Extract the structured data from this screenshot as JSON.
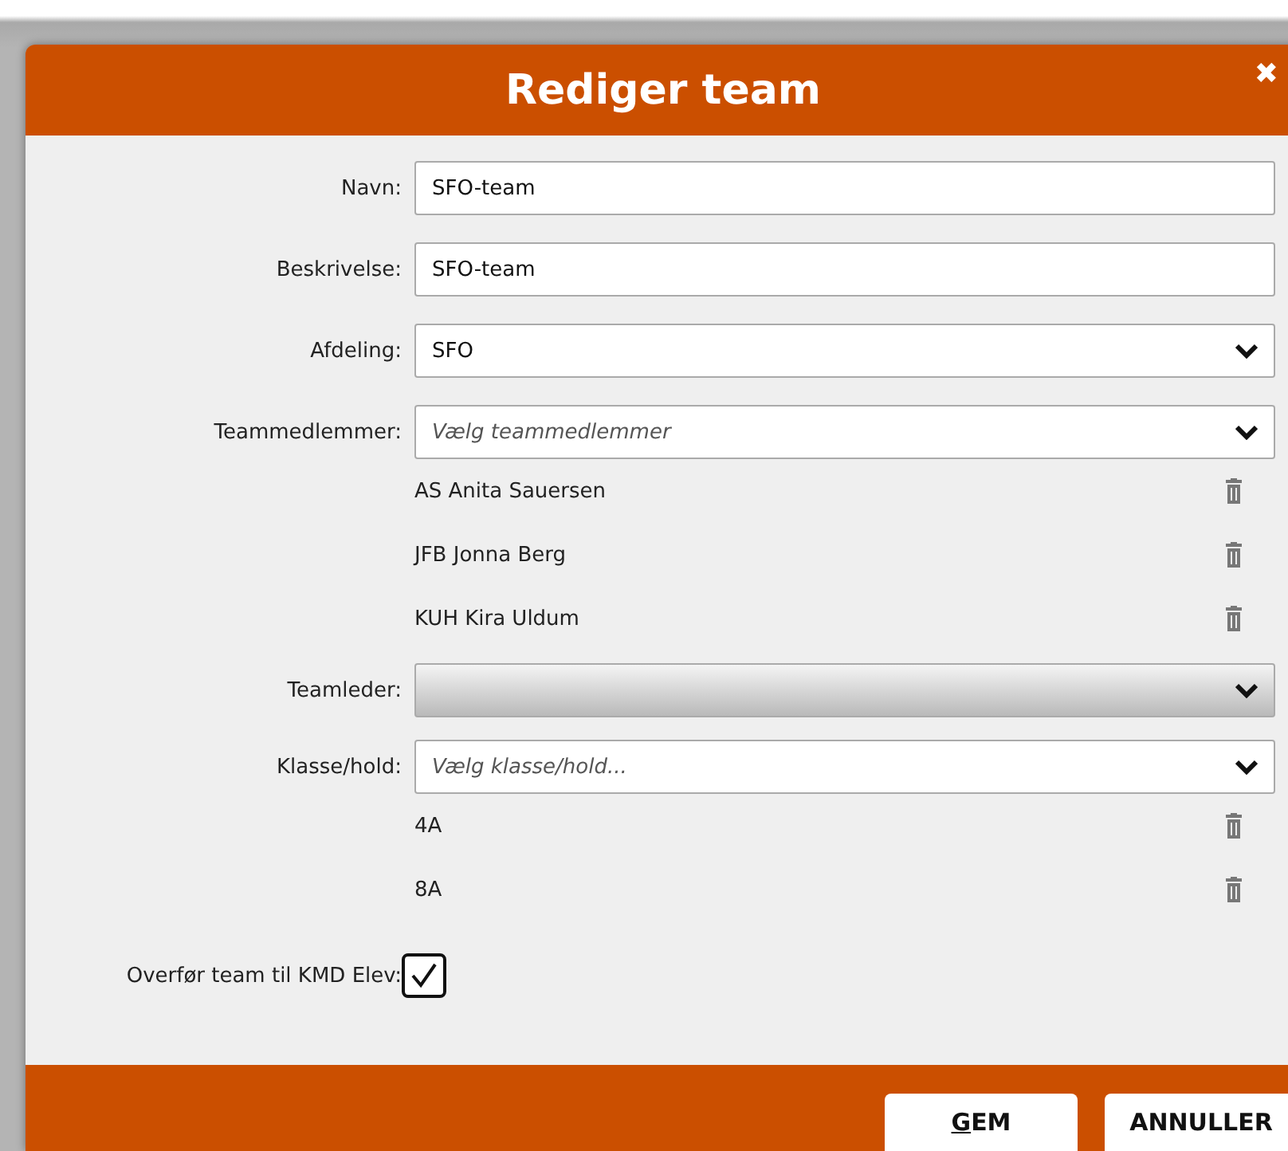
{
  "dialog": {
    "title": "Rediger team",
    "close": "✖",
    "fields": [
      {
        "kind": "text",
        "label": "Navn:",
        "value": "SFO-team"
      },
      {
        "kind": "text",
        "label": "Beskrivelse:",
        "value": "SFO-team"
      },
      {
        "kind": "select",
        "label": "Afdeling:",
        "value": "SFO",
        "disabled": false
      },
      {
        "kind": "select",
        "label": "Teammedlemmer:",
        "placeholder": "Vælg teammedlemmer",
        "disabled": false,
        "items": [
          "AS Anita Sauersen",
          "JFB Jonna Berg",
          "KUH Kira Uldum"
        ]
      },
      {
        "kind": "select",
        "label": "Teamleder:",
        "disabled": true
      },
      {
        "kind": "select",
        "label": "Klasse/hold:",
        "placeholder": "Vælg klasse/hold...",
        "disabled": false,
        "items": [
          "4A",
          "8A"
        ]
      },
      {
        "kind": "checkbox",
        "label": "Overfør team til KMD Elev:",
        "checked": true
      }
    ],
    "buttons": [
      {
        "label": "GEM",
        "mnemonic": true
      },
      {
        "label": "ANNULLER",
        "mnemonic": false
      }
    ]
  }
}
